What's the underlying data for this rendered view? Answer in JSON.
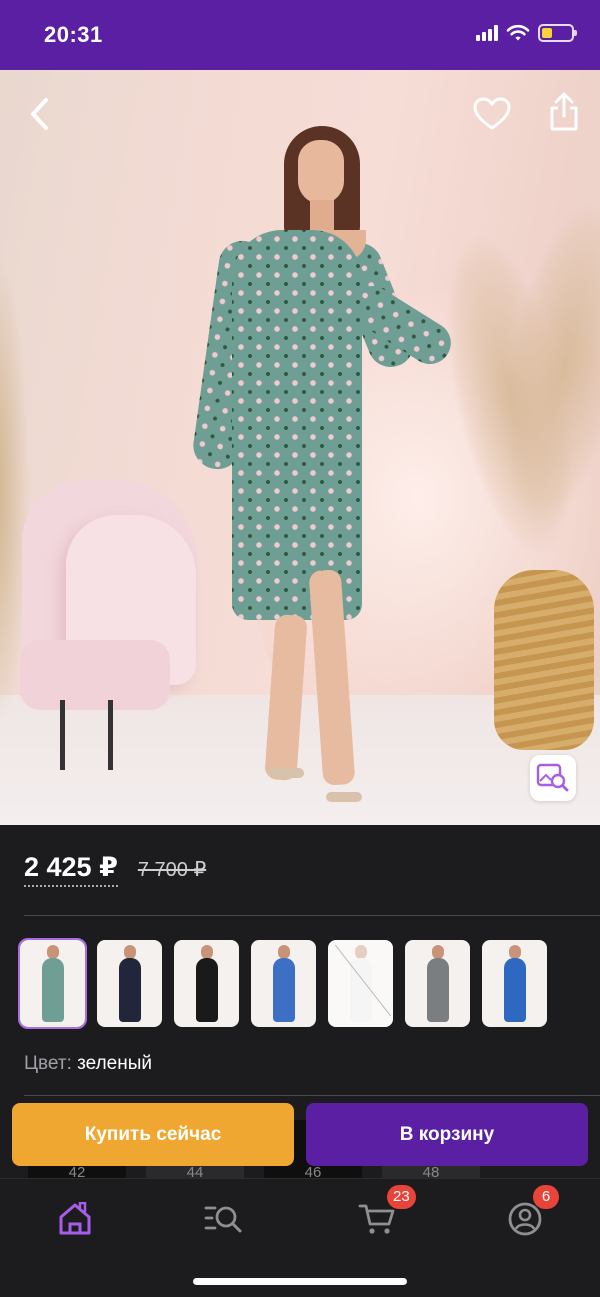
{
  "status_bar": {
    "time": "20:31",
    "battery_level": 0.35,
    "colors": {
      "background": "#5a1fa3",
      "battery": "#f5d33c"
    }
  },
  "product": {
    "price": "2 425 ₽",
    "old_price": "7 700 ₽",
    "color_label": "Цвет:",
    "color_value": "зеленый",
    "variants": [
      {
        "color": "#6f9e95",
        "selected": true
      },
      {
        "color": "#22263a",
        "selected": false
      },
      {
        "color": "#1a1a1a",
        "selected": false
      },
      {
        "color": "#3d6fc4",
        "selected": false
      },
      {
        "color": "#e8e8ea",
        "selected": false,
        "unavailable": true
      },
      {
        "color": "#7a7e80",
        "selected": false
      },
      {
        "color": "#2f68c0",
        "selected": false
      }
    ]
  },
  "sizes": [
    "42",
    "44",
    "46",
    "48"
  ],
  "actions": {
    "buy_now": "Купить сейчас",
    "add_to_cart": "В корзину"
  },
  "tab_bar": {
    "cart_badge": "23",
    "profile_badge": "6",
    "colors": {
      "active": "#a65ee8",
      "inactive": "#8e8e93",
      "badge": "#e8443a"
    }
  },
  "icons": [
    "back-icon",
    "heart-icon",
    "share-icon",
    "visual-search-icon",
    "home-icon",
    "catalog-search-icon",
    "cart-icon",
    "profile-icon"
  ]
}
